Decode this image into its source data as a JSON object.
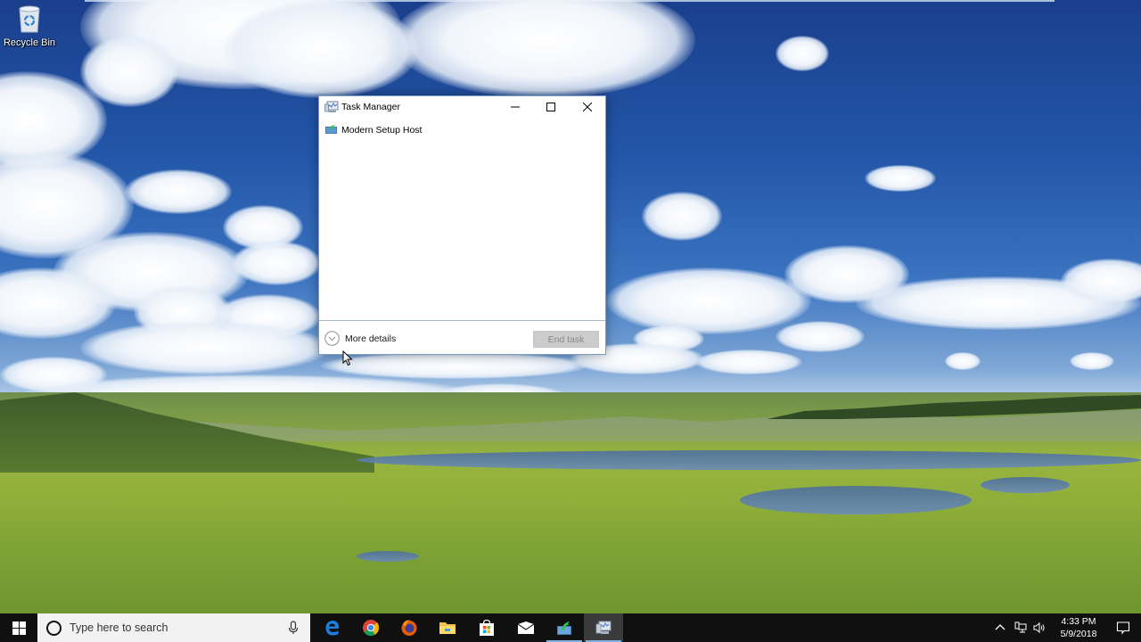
{
  "desktop": {
    "icons": [
      {
        "label": "Recycle Bin",
        "icon": "recycle-bin-icon"
      }
    ]
  },
  "task_manager": {
    "title": "Task Manager",
    "title_icon": "task-manager-icon",
    "controls": {
      "minimize": "minimize-icon",
      "maximize": "maximize-icon",
      "close": "close-icon"
    },
    "processes": [
      {
        "name": "Modern Setup Host",
        "icon": "setup-host-icon"
      }
    ],
    "footer": {
      "more_details_label": "More details",
      "end_task_label": "End task",
      "end_task_enabled": false
    }
  },
  "taskbar": {
    "search_placeholder": "Type here to search",
    "apps": [
      {
        "name": "Microsoft Edge",
        "icon": "edge-icon",
        "running": false
      },
      {
        "name": "Google Chrome",
        "icon": "chrome-icon",
        "running": false
      },
      {
        "name": "Firefox",
        "icon": "firefox-icon",
        "running": false
      },
      {
        "name": "File Explorer",
        "icon": "file-explorer-icon",
        "running": false
      },
      {
        "name": "Microsoft Store",
        "icon": "store-icon",
        "running": false
      },
      {
        "name": "Mail",
        "icon": "mail-icon",
        "running": false
      },
      {
        "name": "Modern Setup Host",
        "icon": "setup-host-icon",
        "running": true
      },
      {
        "name": "Task Manager",
        "icon": "task-manager-icon",
        "running": true,
        "active": true
      }
    ],
    "tray": {
      "icons": [
        "chevron-up-icon",
        "network-icon",
        "volume-icon"
      ],
      "time": "4:33 PM",
      "date": "5/9/2018",
      "notification_icon": "action-center-icon"
    }
  }
}
